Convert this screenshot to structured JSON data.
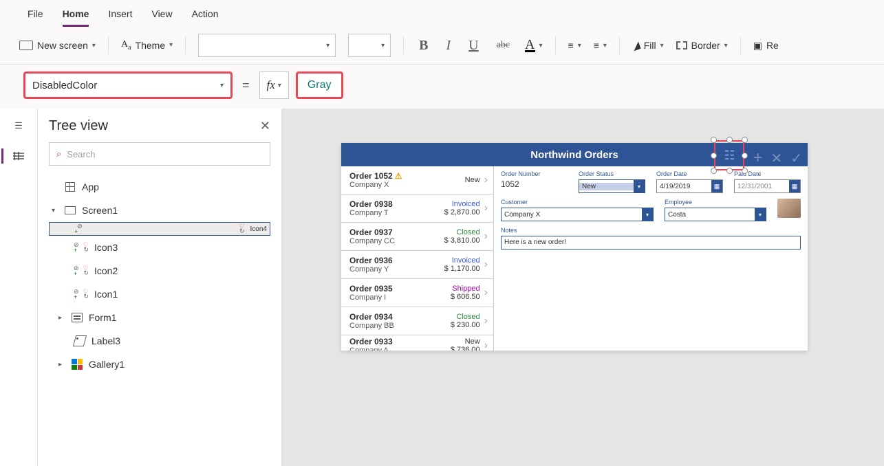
{
  "tabs": {
    "file": "File",
    "home": "Home",
    "insert": "Insert",
    "view": "View",
    "action": "Action"
  },
  "ribbon": {
    "new_screen": "New screen",
    "theme": "Theme",
    "fill": "Fill",
    "border": "Border",
    "re": "Re"
  },
  "formula": {
    "property": "DisabledColor",
    "value": "Gray",
    "fx": "fx"
  },
  "tree": {
    "title": "Tree view",
    "search": "Search",
    "items": [
      {
        "label": "App"
      },
      {
        "label": "Screen1"
      },
      {
        "label": "Icon4"
      },
      {
        "label": "Icon3"
      },
      {
        "label": "Icon2"
      },
      {
        "label": "Icon1"
      },
      {
        "label": "Form1"
      },
      {
        "label": "Label3"
      },
      {
        "label": "Gallery1"
      }
    ]
  },
  "app": {
    "title": "Northwind Orders",
    "orders": [
      {
        "name": "Order 1052",
        "company": "Company X",
        "status": "New",
        "statusClass": "st-new",
        "amount": "",
        "warn": true
      },
      {
        "name": "Order 0938",
        "company": "Company T",
        "status": "Invoiced",
        "statusClass": "st-invoiced",
        "amount": "$ 2,870.00"
      },
      {
        "name": "Order 0937",
        "company": "Company CC",
        "status": "Closed",
        "statusClass": "st-closed",
        "amount": "$ 3,810.00"
      },
      {
        "name": "Order 0936",
        "company": "Company Y",
        "status": "Invoiced",
        "statusClass": "st-invoiced",
        "amount": "$ 1,170.00"
      },
      {
        "name": "Order 0935",
        "company": "Company I",
        "status": "Shipped",
        "statusClass": "st-shipped",
        "amount": "$ 606.50"
      },
      {
        "name": "Order 0934",
        "company": "Company BB",
        "status": "Closed",
        "statusClass": "st-closed",
        "amount": "$ 230.00"
      },
      {
        "name": "Order 0933",
        "company": "Company A",
        "status": "New",
        "statusClass": "st-new",
        "amount": "$ 736.00"
      }
    ],
    "form": {
      "labels": {
        "orderNumber": "Order Number",
        "orderStatus": "Order Status",
        "orderDate": "Order Date",
        "paidDate": "Paid Date",
        "customer": "Customer",
        "employee": "Employee",
        "notes": "Notes"
      },
      "values": {
        "orderNumber": "1052",
        "orderStatus": "New",
        "orderDate": "4/19/2019",
        "paidDate": "12/31/2001",
        "customer": "Company X",
        "employee": "Costa",
        "notes": "Here is a new order!"
      }
    }
  }
}
